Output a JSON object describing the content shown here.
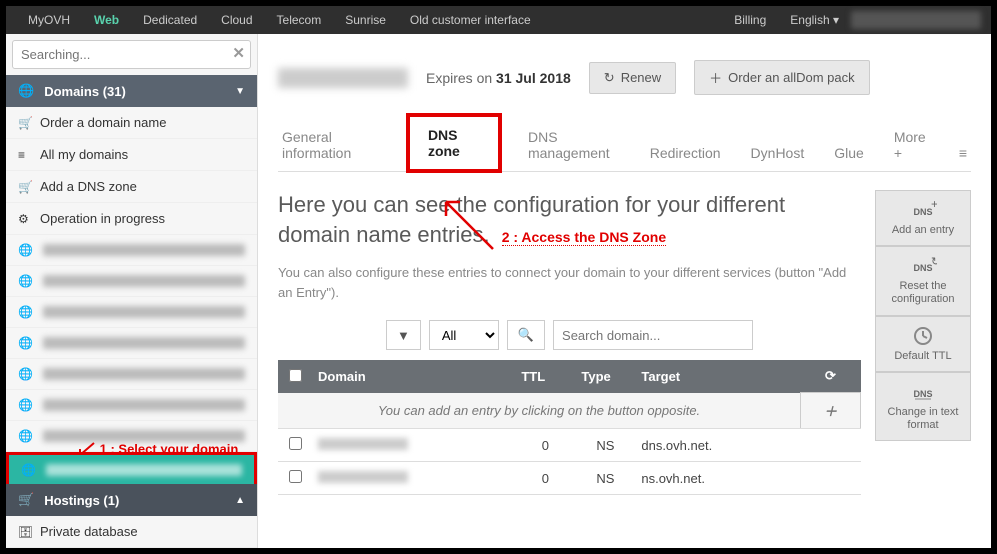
{
  "topnav": {
    "brand": "MyOVH",
    "items": [
      "Web",
      "Dedicated",
      "Cloud",
      "Telecom",
      "Sunrise",
      "Old customer interface"
    ],
    "active": 0,
    "right": {
      "billing": "Billing",
      "lang": "English"
    }
  },
  "search": {
    "placeholder": "Searching..."
  },
  "sidebar": {
    "domains": {
      "title": "Domains (31)",
      "links": [
        {
          "icon": "cart",
          "label": "Order a domain name"
        },
        {
          "icon": "list",
          "label": "All my domains"
        },
        {
          "icon": "cart",
          "label": "Add a DNS zone"
        },
        {
          "icon": "gears",
          "label": "Operation in progress"
        }
      ]
    },
    "hostings": {
      "title": "Hostings (1)",
      "child": "Private database"
    }
  },
  "annotations": {
    "step1": "1 : Select your domain",
    "step2": "2 : Access the DNS Zone"
  },
  "header": {
    "expires_prefix": "Expires on ",
    "expires_date": "31 Jul 2018",
    "renew": "Renew",
    "order_alldom": "Order an allDom pack"
  },
  "tabs": {
    "items": [
      "General information",
      "DNS zone",
      "DNS management",
      "Redirection",
      "DynHost",
      "Glue",
      "More +"
    ],
    "active": 1
  },
  "description": "Here you can see the configuration for your different domain name entries.",
  "hint": "You can also configure these entries to connect your domain to your different services (button \"Add an Entry\").",
  "filter": {
    "all": "All",
    "search_placeholder": "Search domain..."
  },
  "table": {
    "cols": {
      "domain": "Domain",
      "ttl": "TTL",
      "type": "Type",
      "target": "Target"
    },
    "empty": "You can add an entry by clicking on the button opposite.",
    "rows": [
      {
        "ttl": "0",
        "type": "NS",
        "target": "dns.ovh.net."
      },
      {
        "ttl": "0",
        "type": "NS",
        "target": "ns.ovh.net."
      }
    ]
  },
  "actions": {
    "add": "Add an entry",
    "reset": "Reset the configuration",
    "default_ttl": "Default TTL",
    "text_fmt": "Change in text format"
  }
}
